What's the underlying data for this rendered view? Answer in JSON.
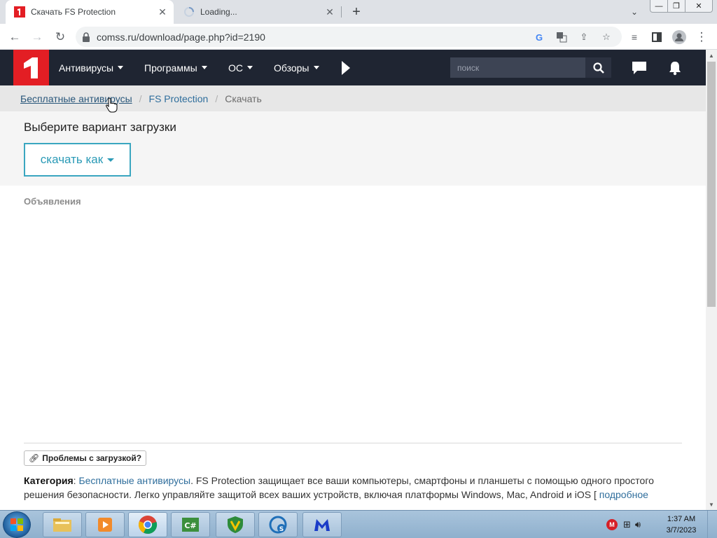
{
  "browser": {
    "tabs": [
      {
        "title": "Скачать FS Protection",
        "active": true
      },
      {
        "title": "Loading...",
        "active": false
      }
    ],
    "url": "comss.ru/download/page.php?id=2190"
  },
  "site": {
    "nav": [
      "Антивирусы",
      "Программы",
      "ОС",
      "Обзоры"
    ],
    "search_placeholder": "поиск"
  },
  "breadcrumb": {
    "items": [
      "Бесплатные антивирусы",
      "FS Protection"
    ],
    "current": "Скачать",
    "separator": "/"
  },
  "download": {
    "title": "Выберите вариант загрузки",
    "button": "скачать как"
  },
  "ads_label": "Объявления",
  "problem_button": "Проблемы с загрузкой?",
  "description": {
    "category_label": "Категория",
    "category_sep": ":",
    "category_link": "Бесплатные антивирусы",
    "text": ". FS Protection защищает все ваши компьютеры, смартфоны и планшеты с помощью одного простого решения безопасности. Легко управляйте защитой всех ваших устройств, включая платформы Windows, Mac, Android и iOS [",
    "more_link": "подробное"
  },
  "taskbar": {
    "time": "1:37 AM",
    "date": "3/7/2023"
  },
  "colors": {
    "header": "#1f2532",
    "logo": "#e31e24",
    "accent": "#2a9ab6",
    "link": "#2f6e9c"
  }
}
